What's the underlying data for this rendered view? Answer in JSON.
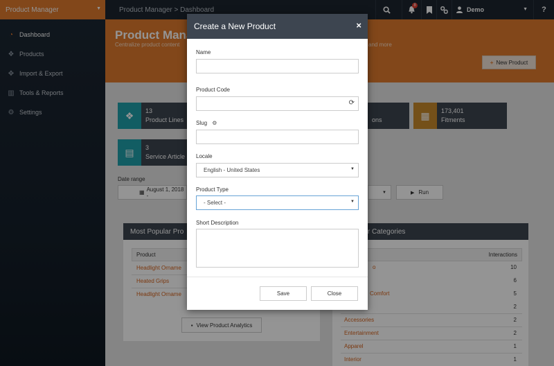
{
  "sidebar": {
    "brand": "Product Manager",
    "items": [
      {
        "label": "Dashboard",
        "icon": "dashboard-icon"
      },
      {
        "label": "Products",
        "icon": "cubes-icon"
      },
      {
        "label": "Import & Export",
        "icon": "arrows-icon"
      },
      {
        "label": "Tools & Reports",
        "icon": "chart-icon"
      },
      {
        "label": "Settings",
        "icon": "gear-icon"
      }
    ]
  },
  "topbar": {
    "breadcrumb": "Product Manager > Dashboard",
    "notification_count": "8",
    "user": "Demo",
    "help": "?"
  },
  "header": {
    "title": "Product Mana",
    "subtitle": "Centralize product content",
    "subtitle_tail": "and more",
    "new_product": "New Product"
  },
  "tiles": [
    {
      "value": "13",
      "label": "Product Lines",
      "color": "#1fa0ab"
    },
    {
      "value": "",
      "label": "ons",
      "color": "#1fa0ab"
    },
    {
      "value": "173,401",
      "label": "Fitments",
      "color": "#c88b2c"
    },
    {
      "value": "3",
      "label": "Service Article",
      "color": "#1fa0ab"
    }
  ],
  "date_range": {
    "label": "Date range",
    "value": "August 1, 2018 -",
    "run": "Run"
  },
  "popular_products": {
    "title": "Most Popular Pro",
    "column": "Product",
    "rows": [
      "Headlight Orname",
      "Heated Grips",
      "Headlight Orname"
    ],
    "analytics_button": "View Product Analytics"
  },
  "popular_categories": {
    "title": "pular Categories",
    "interactions_col": "Interactions",
    "rows": [
      {
        "name": "o",
        "value": "10"
      },
      {
        "name": "",
        "value": "6"
      },
      {
        "name": "Comfort",
        "value": "5"
      },
      {
        "name": "",
        "value": "2"
      },
      {
        "name": "Accessories",
        "value": "2"
      },
      {
        "name": "Entertainment",
        "value": "2"
      },
      {
        "name": "Apparel",
        "value": "1"
      },
      {
        "name": "Interior",
        "value": "1"
      }
    ]
  },
  "modal": {
    "title": "Create a New Product",
    "name_label": "Name",
    "code_label": "Product Code",
    "slug_label": "Slug",
    "locale_label": "Locale",
    "locale_value": "English - United States",
    "type_label": "Product Type",
    "type_value": "- Select -",
    "desc_label": "Short Description",
    "save": "Save",
    "close": "Close"
  }
}
